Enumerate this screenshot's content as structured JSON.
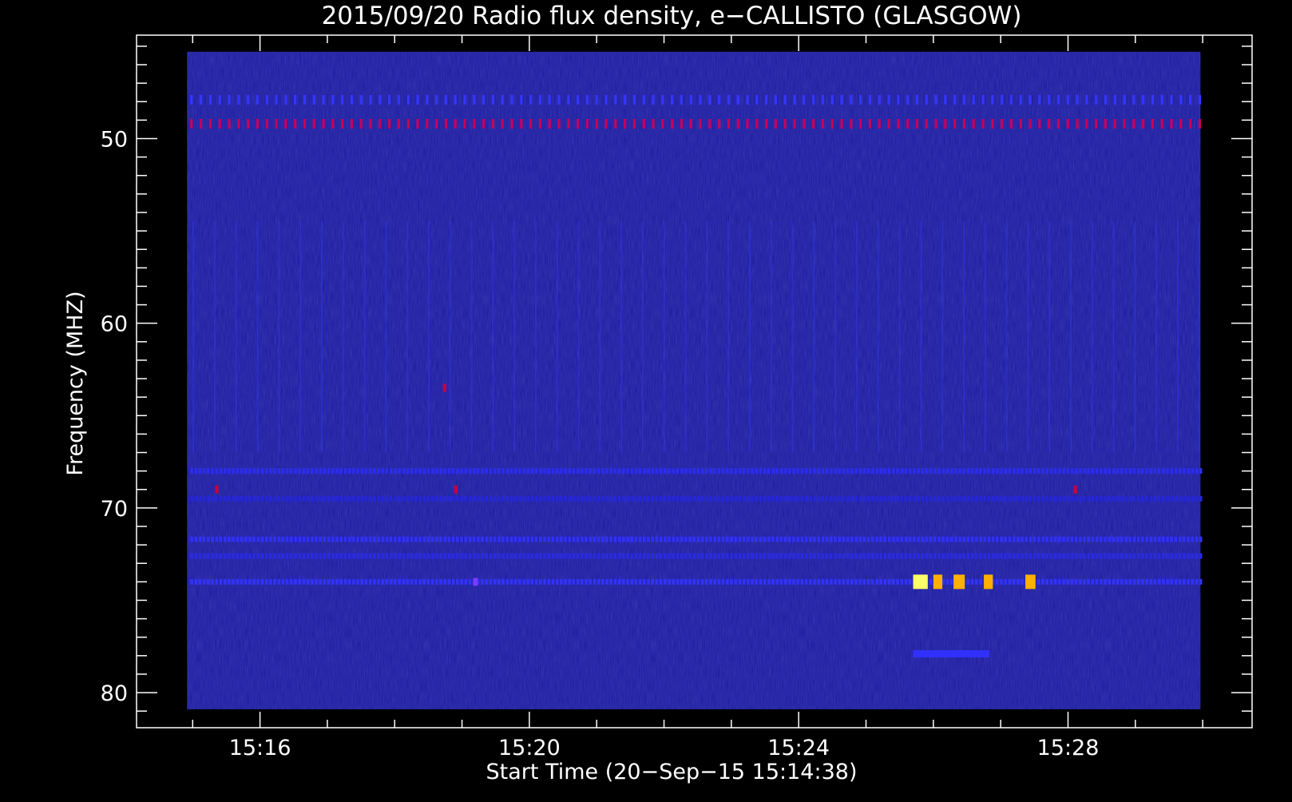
{
  "chart_data": {
    "type": "heatmap",
    "title": "2015/09/20  Radio flux density, e−CALLISTO (GLASGOW)",
    "xlabel": "Start Time (20−Sep−15 15:14:38)",
    "ylabel": "Frequency (MHZ)",
    "x_unit": "UT time (HH:MM:SS)",
    "y_unit": "MHz",
    "xlim": [
      "15:14:10",
      "15:30:44"
    ],
    "ylim": [
      81.9,
      44.4
    ],
    "y_axis_inverted": true,
    "data_extent": {
      "x": [
        "15:14:55",
        "15:29:58"
      ],
      "y": [
        45.3,
        80.9
      ]
    },
    "x_major_ticks": [
      {
        "value": "15:16:00",
        "label": "15:16"
      },
      {
        "value": "15:20:00",
        "label": "15:20"
      },
      {
        "value": "15:24:00",
        "label": "15:24"
      },
      {
        "value": "15:28:00",
        "label": "15:28"
      }
    ],
    "y_major_ticks": [
      {
        "value": 50,
        "label": "50"
      },
      {
        "value": 60,
        "label": "60"
      },
      {
        "value": 70,
        "label": "70"
      },
      {
        "value": 80,
        "label": "80"
      }
    ],
    "colormap": [
      "#000000",
      "#1a1aa8",
      "#3c28ff",
      "#c80040",
      "#ff0000",
      "#ffb000",
      "#ffff66"
    ],
    "background_level": "#1a1a9e",
    "frame_color": "#ffffff",
    "features": [
      {
        "kind": "periodic interference band",
        "freq": 47.9,
        "t_start": "15:14:55",
        "t_end": "15:29:58",
        "level": "medium",
        "color": "#3434ff"
      },
      {
        "kind": "periodic interference band",
        "freq": 49.2,
        "t_start": "15:14:55",
        "t_end": "15:29:58",
        "level": "high",
        "color": "#c8005a"
      },
      {
        "kind": "interference band",
        "freq": 68.0,
        "t_start": "15:14:55",
        "t_end": "15:29:58",
        "level": "medium",
        "color": "#2c2cee"
      },
      {
        "kind": "interference band",
        "freq": 69.5,
        "t_start": "15:14:55",
        "t_end": "15:29:58",
        "level": "low",
        "color": "#2626d8"
      },
      {
        "kind": "interference band",
        "freq": 71.7,
        "t_start": "15:14:55",
        "t_end": "15:29:58",
        "level": "medium",
        "color": "#3030f5"
      },
      {
        "kind": "interference band",
        "freq": 72.6,
        "t_start": "15:14:55",
        "t_end": "15:29:58",
        "level": "low",
        "color": "#2a2ae0"
      },
      {
        "kind": "interference band",
        "freq": 74.0,
        "t_start": "15:14:55",
        "t_end": "15:29:58",
        "level": "medium",
        "color": "#3232f8"
      },
      {
        "kind": "burst",
        "freq": 74.0,
        "t_start": "15:25:42",
        "t_end": "15:25:55",
        "level": "peak",
        "color": "#ffff66"
      },
      {
        "kind": "burst",
        "freq": 74.0,
        "t_start": "15:26:00",
        "t_end": "15:26:08",
        "level": "high",
        "color": "#ffb000"
      },
      {
        "kind": "burst",
        "freq": 74.0,
        "t_start": "15:26:18",
        "t_end": "15:26:22",
        "level": "high",
        "color": "#ffb000"
      },
      {
        "kind": "burst",
        "freq": 74.0,
        "t_start": "15:26:20",
        "t_end": "15:26:28",
        "level": "high",
        "color": "#ffb000"
      },
      {
        "kind": "burst",
        "freq": 74.0,
        "t_start": "15:26:45",
        "t_end": "15:26:53",
        "level": "high",
        "color": "#ffb000"
      },
      {
        "kind": "burst",
        "freq": 74.0,
        "t_start": "15:27:22",
        "t_end": "15:27:31",
        "level": "high",
        "color": "#ffb000"
      },
      {
        "kind": "weak burst",
        "freq": 77.9,
        "t_start": "15:25:42",
        "t_end": "15:26:50",
        "level": "medium",
        "color": "#3030ff"
      },
      {
        "kind": "spot",
        "freq": 63.5,
        "t_start": "15:18:43",
        "t_end": "15:18:46",
        "level": "medium",
        "color": "#c80040"
      },
      {
        "kind": "spot",
        "freq": 69.0,
        "t_start": "15:15:20",
        "t_end": "15:15:23",
        "level": "medium",
        "color": "#c80040"
      },
      {
        "kind": "spot",
        "freq": 69.0,
        "t_start": "15:18:53",
        "t_end": "15:18:56",
        "level": "medium",
        "color": "#c80040"
      },
      {
        "kind": "spot",
        "freq": 69.0,
        "t_start": "15:28:05",
        "t_end": "15:28:08",
        "level": "medium",
        "color": "#c80040"
      },
      {
        "kind": "spot",
        "freq": 74.0,
        "t_start": "15:19:10",
        "t_end": "15:19:14",
        "level": "medium",
        "color": "#7a3cff"
      }
    ]
  }
}
